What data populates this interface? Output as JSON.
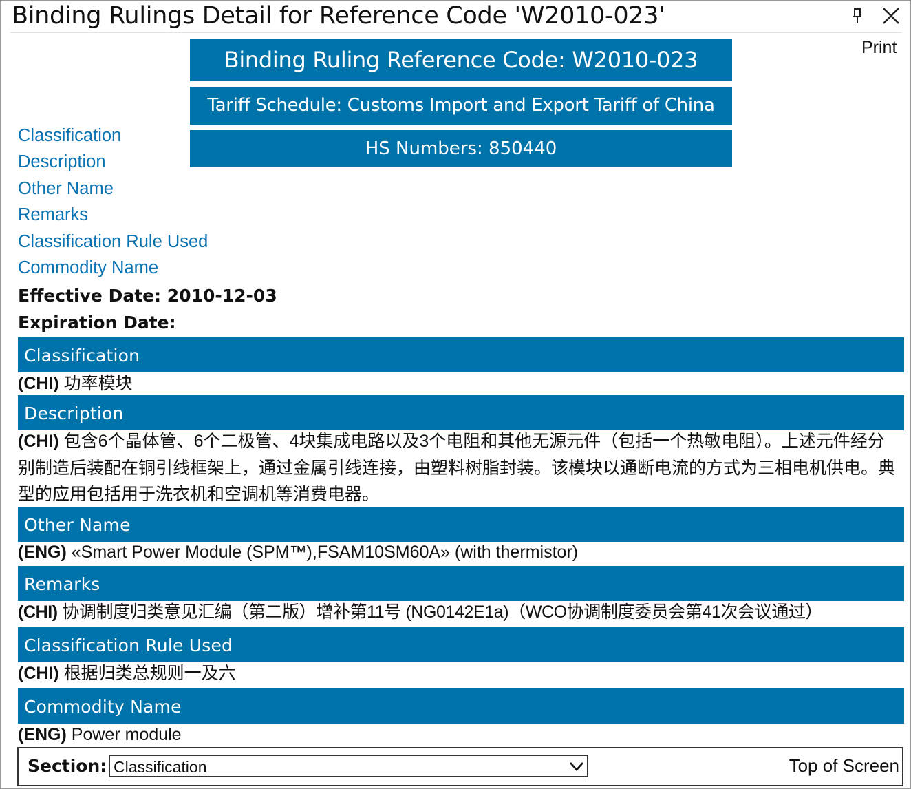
{
  "window": {
    "title": "Binding Rulings Detail for Reference Code 'W2010-023'"
  },
  "toolbar": {
    "print_label": "Print"
  },
  "banners": {
    "reference": "Binding Ruling Reference Code: W2010-023",
    "tariff": "Tariff Schedule: Customs Import and Export Tariff of China",
    "hs": "HS Numbers: 850440"
  },
  "nav": {
    "items": [
      "Classification",
      "Description",
      "Other Name",
      "Remarks",
      "Classification Rule Used",
      "Commodity Name"
    ]
  },
  "dates": {
    "effective": "Effective Date: 2010-12-03",
    "expiration": "Expiration Date:"
  },
  "sections": [
    {
      "title": "Classification",
      "lang": "(CHI)",
      "text": "功率模块"
    },
    {
      "title": "Description",
      "lang": "(CHI)",
      "text": "包含6个晶体管、6个二极管、4块集成电路以及3个电阻和其他无源元件（包括一个热敏电阻）。上述元件经分别制造后装配在铜引线框架上，通过金属引线连接，由塑料树脂封装。该模块以通断电流的方式为三相电机供电。典型的应用包括用于洗衣机和空调机等消费电器。"
    },
    {
      "title": "Other Name",
      "lang": "(ENG)",
      "text": "«Smart Power Module (SPM™),FSAM10SM60A» (with thermistor)"
    },
    {
      "title": "Remarks",
      "lang": "(CHI)",
      "text": "协调制度归类意见汇编（第二版）增补第11号 (NG0142E1a)（WCO协调制度委员会第41次会议通过）"
    },
    {
      "title": "Classification Rule Used",
      "lang": "(CHI)",
      "text": "根据归类总规则一及六"
    },
    {
      "title": "Commodity Name",
      "lang": "(ENG)",
      "text": "Power module"
    }
  ],
  "footer": {
    "section_label": "Section:",
    "section_selected": "Classification",
    "top_link": "Top of Screen"
  },
  "colors": {
    "accent": "#0073aa",
    "link": "#0a73b1"
  }
}
